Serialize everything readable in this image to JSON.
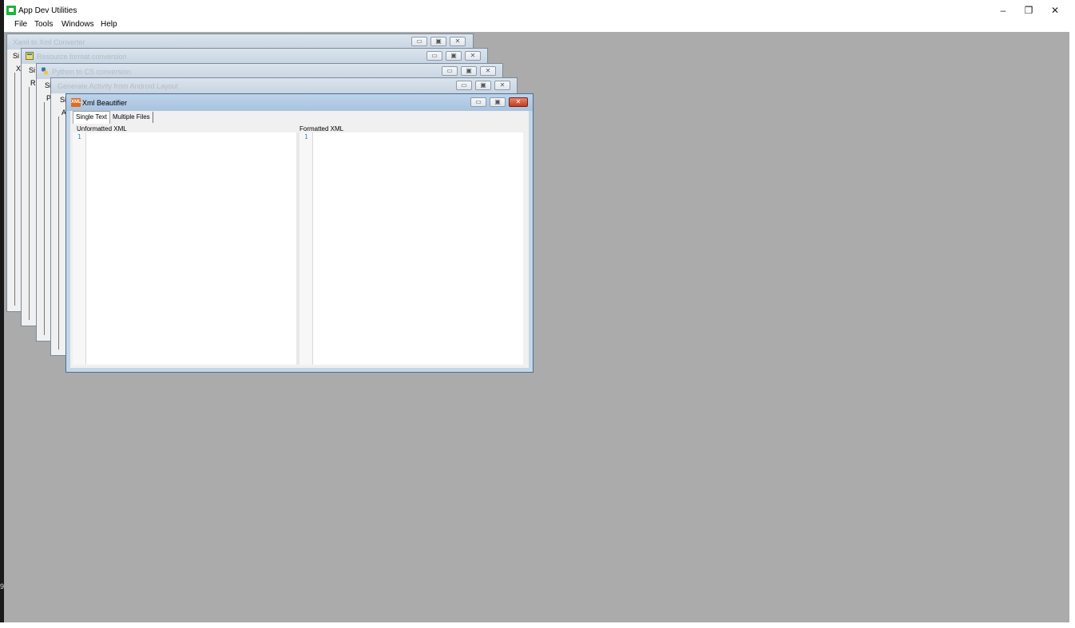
{
  "app": {
    "title": "App Dev Utilities",
    "controls": {
      "minimize": "–",
      "restore": "❐",
      "close": "✕"
    }
  },
  "side_mark": "9",
  "menu": [
    {
      "label": "File"
    },
    {
      "label": "Tools"
    },
    {
      "label": "Windows"
    },
    {
      "label": "Help"
    }
  ],
  "child_windows": [
    {
      "title": "Xaml to Xml Converter",
      "peek": [
        "Si",
        "X"
      ]
    },
    {
      "title": "Resource format conversion",
      "peek": [
        "Si",
        "R"
      ]
    },
    {
      "title": "Python to CS conversion",
      "peek": [
        "Si",
        "P"
      ]
    },
    {
      "title": "Generate Activity from Android Layout",
      "peek": [
        "Si",
        "A"
      ]
    }
  ],
  "active_window": {
    "title": "Xml Beautifier",
    "icon_text": "XML",
    "tabs": [
      "Single Text",
      "Multiple Files"
    ],
    "active_tab": "Single Text",
    "left_pane": {
      "label": "Unformatted XML",
      "line": "1"
    },
    "right_pane": {
      "label": "Formatted XML",
      "line": "1"
    }
  },
  "colors": {
    "mdi_background": "#ababab",
    "app_icon": "#1db33b",
    "active_title": "#a9c3de",
    "close_button": "#c13d24"
  }
}
